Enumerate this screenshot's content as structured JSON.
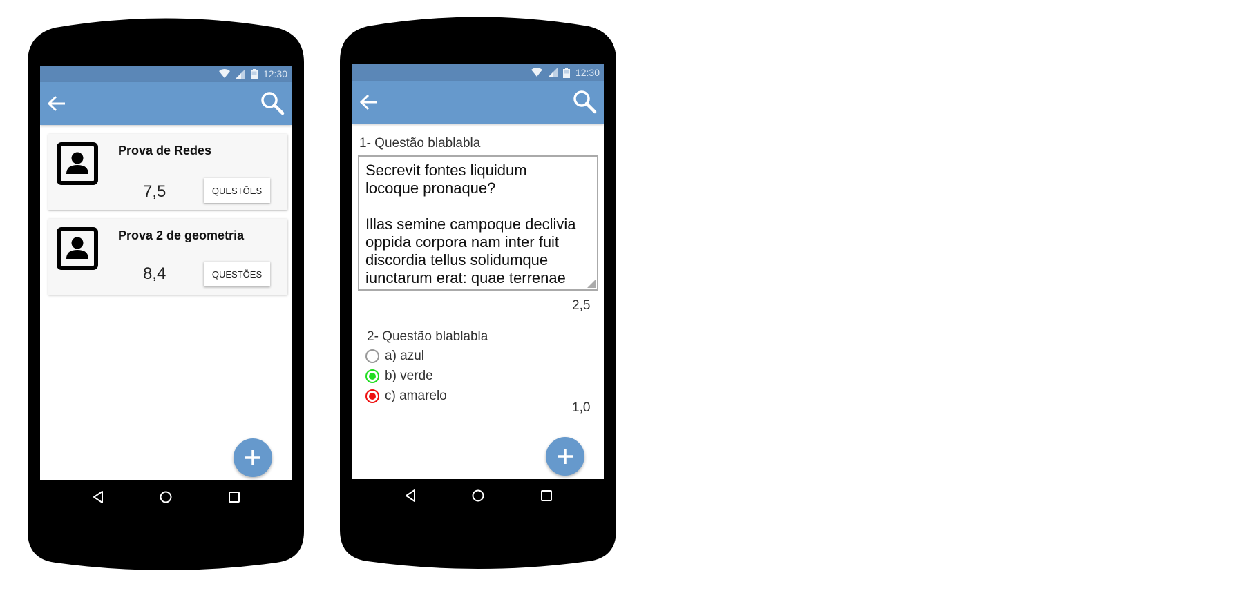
{
  "status_bar": {
    "time": "12:30"
  },
  "phone1": {
    "cards": [
      {
        "title": "Prova de Redes",
        "grade": "7,5",
        "button_label": "QUESTÕES"
      },
      {
        "title": "Prova 2 de geometria",
        "grade": "8,4",
        "button_label": "QUESTÕES"
      }
    ]
  },
  "phone2": {
    "question1": {
      "label": "1- Questão blablabla",
      "answer_line1": "Secrevit fontes liquidum",
      "answer_line2": "locoque pronaque?",
      "answer_line3": "Illas semine campoque declivia",
      "answer_line4": "oppida corpora nam inter fuit",
      "answer_line5": "discordia tellus solidumque",
      "answer_line6": "iunctarum erat: quae terrenae",
      "score": "2,5"
    },
    "question2": {
      "label": "2- Questão blablabla",
      "options": [
        {
          "label": "a) azul",
          "state": "unselected"
        },
        {
          "label": "b) verde",
          "state": "correct"
        },
        {
          "label": "c) amarelo",
          "state": "wrong"
        }
      ],
      "score": "1,0"
    }
  },
  "icons": {
    "back": "arrow-left-icon",
    "search": "magnifier-icon",
    "fab": "plus-icon",
    "avatar": "contact-card-icon",
    "nav": [
      "back-triangle-icon",
      "home-circle-icon",
      "recents-square-icon"
    ],
    "status": [
      "wifi-icon",
      "signal-icon",
      "battery-icon"
    ]
  },
  "colors": {
    "app_bar": "#6699cc",
    "status_bar": "#5b87b7",
    "fab": "#6699cc",
    "correct": "#22dd22",
    "wrong": "#ee1111"
  }
}
